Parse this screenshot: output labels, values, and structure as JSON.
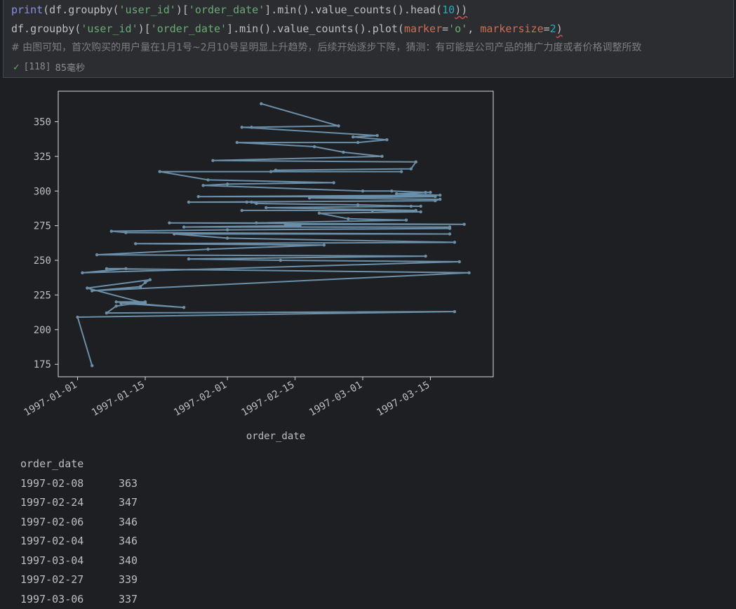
{
  "cell": {
    "line1": {
      "print_kw": "print",
      "p1": "(df.groupby(",
      "s1": "'user_id'",
      "p2": ")[",
      "s2": "'order_date'",
      "p3": "].min().value_counts().head(",
      "n1": "10",
      "p4": "))"
    },
    "line2": {
      "p1": "df.groupby(",
      "s1": "'user_id'",
      "p2": ")[",
      "s2": "'order_date'",
      "p3": "].min().value_counts().plot(",
      "param1": "marker",
      "eq1": "=",
      "s3": "'o'",
      "sep": ", ",
      "param2": "markersize",
      "eq2": "=",
      "n1": "2",
      "p4": ")"
    },
    "comment": "# 由图可知，首次购买的用户量在1月1号~2月10号呈明显上升趋势，后续开始逐步下降，猜测：有可能是公司产品的推广力度或者价格调整所致",
    "exec_count": "[118]",
    "exec_time": "85毫秒"
  },
  "colors": {
    "line": "#6b8fa8",
    "axes_bg": "#1e1f22",
    "frame": "#d8d8d8",
    "text": "#bcbec4"
  },
  "chart_data": {
    "type": "line",
    "xlabel": "order_date",
    "ylabel": "",
    "x_ticks": [
      "1997-01-01",
      "1997-01-15",
      "1997-02-01",
      "1997-02-15",
      "1997-03-01",
      "1997-03-15"
    ],
    "y_ticks": [
      175,
      200,
      225,
      250,
      275,
      300,
      325,
      350
    ],
    "xlim": [
      "1996-12-28",
      "1997-03-28"
    ],
    "ylim": [
      166,
      372
    ],
    "marker": "o",
    "series": [
      {
        "x": [
          "1997-02-08",
          "1997-02-24",
          "1997-02-06",
          "1997-02-04",
          "1997-03-04",
          "1997-02-27",
          "1997-03-06",
          "1997-02-28",
          "1997-02-03",
          "1997-02-19",
          "1997-02-25",
          "1997-03-05",
          "1997-01-29",
          "1997-03-12",
          "1997-03-11",
          "1997-02-11",
          "1997-02-10",
          "1997-03-09",
          "1997-01-18",
          "1997-01-28",
          "1997-02-23",
          "1997-02-01",
          "1997-01-27",
          "1997-03-01",
          "1997-03-07",
          "1997-03-14",
          "1997-03-15",
          "1997-03-08",
          "1997-03-17",
          "1997-01-26",
          "1997-03-16",
          "1997-02-18",
          "1997-03-17",
          "1997-03-16",
          "1997-01-24",
          "1997-02-05",
          "1997-02-06",
          "1997-02-07",
          "1997-02-28",
          "1997-03-13",
          "1997-03-11",
          "1997-02-09",
          "1997-03-12",
          "1997-02-04",
          "1997-03-03",
          "1997-03-13",
          "1997-02-20",
          "1997-02-26",
          "1997-03-10",
          "1997-02-07",
          "1997-01-20",
          "1997-03-22",
          "1997-02-13",
          "1997-02-16",
          "1997-01-23",
          "1997-03-19",
          "1997-03-19",
          "1997-02-01",
          "1997-01-08",
          "1997-01-11",
          "1997-03-19",
          "1997-01-21",
          "1997-02-01",
          "1997-03-20",
          "1997-01-13",
          "1997-02-21",
          "1997-01-28",
          "1997-01-05",
          "1997-03-14",
          "1997-01-24",
          "1997-02-12",
          "1997-03-21",
          "1997-01-02",
          "1997-01-11",
          "1997-01-07",
          "1997-03-23",
          "1997-01-04",
          "1997-01-14",
          "1997-01-15",
          "1997-01-16",
          "1997-01-03",
          "1997-01-15",
          "1997-01-10",
          "1997-01-23",
          "1997-01-09",
          "1997-01-15",
          "1997-01-09",
          "1997-01-07",
          "1997-03-20",
          "1997-01-01",
          "1997-01-04"
        ],
        "y": [
          363,
          347,
          346,
          346,
          340,
          339,
          337,
          335,
          335,
          332,
          328,
          325,
          322,
          321,
          316,
          315,
          314,
          314,
          314,
          308,
          306,
          305,
          304,
          300,
          300,
          299,
          299,
          298,
          297,
          296,
          296,
          295,
          294,
          293,
          292,
          292,
          292,
          291,
          290,
          289,
          289,
          288,
          286,
          286,
          286,
          285,
          284,
          280,
          279,
          277,
          277,
          276,
          276,
          275,
          274,
          274,
          273,
          272,
          271,
          270,
          269,
          269,
          266,
          263,
          262,
          261,
          258,
          254,
          253,
          251,
          250,
          249,
          241,
          244,
          244,
          241,
          228,
          231,
          234,
          236,
          230,
          219,
          219,
          216,
          220,
          220,
          217,
          212,
          213,
          209,
          174
        ]
      }
    ]
  },
  "output": {
    "header": "order_date",
    "rows": [
      {
        "date": "1997-02-08",
        "count": "363"
      },
      {
        "date": "1997-02-24",
        "count": "347"
      },
      {
        "date": "1997-02-06",
        "count": "346"
      },
      {
        "date": "1997-02-04",
        "count": "346"
      },
      {
        "date": "1997-03-04",
        "count": "340"
      },
      {
        "date": "1997-02-27",
        "count": "339"
      },
      {
        "date": "1997-03-06",
        "count": "337"
      }
    ]
  }
}
